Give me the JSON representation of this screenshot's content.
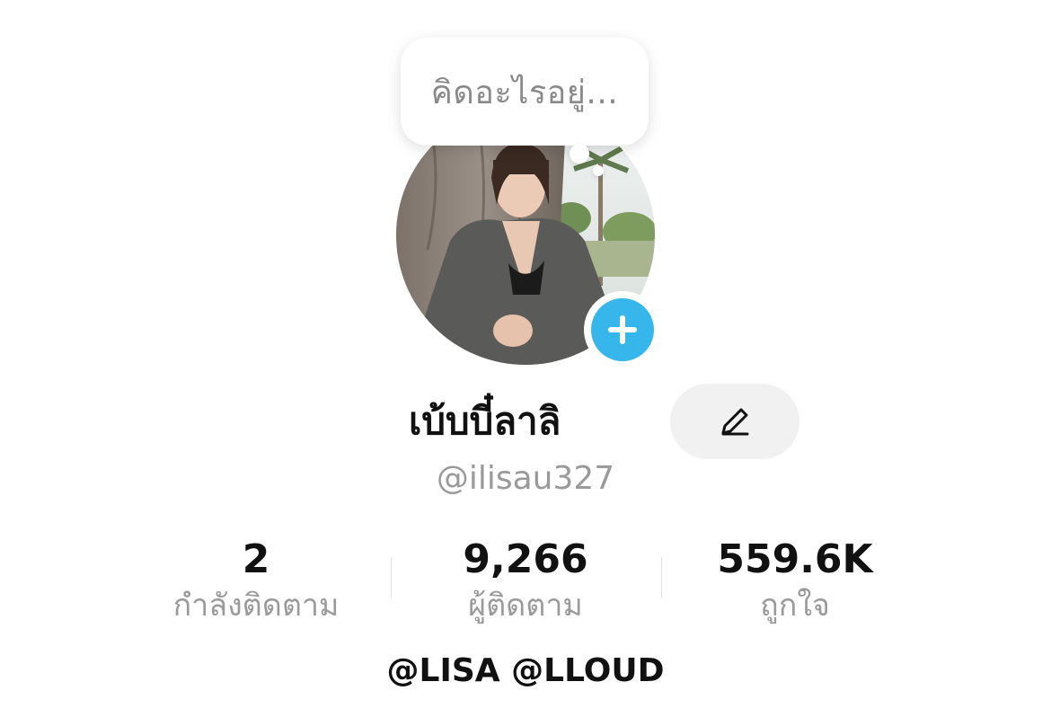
{
  "bubble": {
    "placeholder_text": "คิดอะไรอยู่..."
  },
  "profile": {
    "display_name": "เบ้บบี๋ลาลิ",
    "username": "@ilisau327",
    "bio": "@LISA @LLOUD"
  },
  "stats": [
    {
      "value": "2",
      "label": "กำลังติดตาม"
    },
    {
      "value": "9,266",
      "label": "ผู้ติดตาม"
    },
    {
      "value": "559.6K",
      "label": "ถูกใจ"
    }
  ],
  "icons": {
    "add": "plus-icon",
    "edit": "pencil-icon"
  },
  "colors": {
    "accent": "#37b6ec",
    "muted_text": "#9a9a9a",
    "edit_button_bg": "#f1f1f2"
  }
}
